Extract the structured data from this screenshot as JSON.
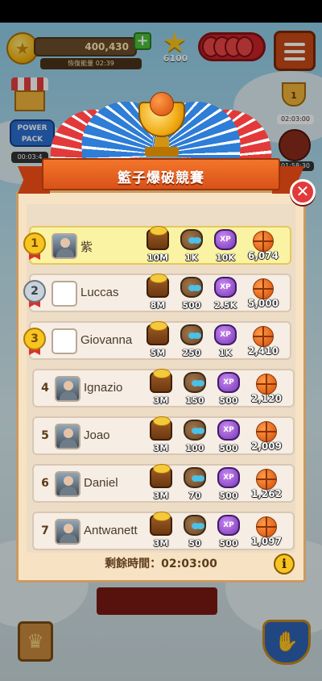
{
  "hud": {
    "coins": "400,430",
    "coin_timer": "恢復能量 02:39",
    "stars": "6100",
    "power_pack_label": "POWER PACK",
    "power_pack_timer": "00:03:4",
    "trophy_event_rank": "1",
    "trophy_event_timer": "02:03:00",
    "ball_event_timer": "01:58:30"
  },
  "tournament": {
    "title": "籃子爆破競賽",
    "remaining_label": "剩餘時間：02:03:00",
    "info_label": "i",
    "close_label": "✕"
  },
  "leaderboard": [
    {
      "rank": "1",
      "name": "紫",
      "coins": "10M",
      "pets": "1K",
      "xp": "10K",
      "score": "6,074",
      "medal": "gold",
      "avatar": "photo"
    },
    {
      "rank": "2",
      "name": "Luccas",
      "coins": "8M",
      "pets": "500",
      "xp": "2.5K",
      "score": "5,000",
      "medal": "silver",
      "avatar": "blank"
    },
    {
      "rank": "3",
      "name": "Giovanna",
      "coins": "5M",
      "pets": "250",
      "xp": "1K",
      "score": "2,410",
      "medal": "gold",
      "avatar": "blank"
    },
    {
      "rank": "4",
      "name": "Ignazio",
      "coins": "3M",
      "pets": "150",
      "xp": "500",
      "score": "2,120",
      "medal": "none",
      "avatar": "photo"
    },
    {
      "rank": "5",
      "name": "Joao",
      "coins": "3M",
      "pets": "100",
      "xp": "500",
      "score": "2,009",
      "medal": "none",
      "avatar": "photo"
    },
    {
      "rank": "6",
      "name": "Daniel",
      "coins": "3M",
      "pets": "70",
      "xp": "500",
      "score": "1,262",
      "medal": "none",
      "avatar": "photo"
    },
    {
      "rank": "7",
      "name": "Antwanett",
      "coins": "3M",
      "pets": "50",
      "xp": "500",
      "score": "1,097",
      "medal": "none",
      "avatar": "photo"
    }
  ],
  "colors": {
    "banner": "#e8621f",
    "panel": "#f7e3c3",
    "first_row": "#fbf3a4",
    "basketball": "#e0631a"
  }
}
